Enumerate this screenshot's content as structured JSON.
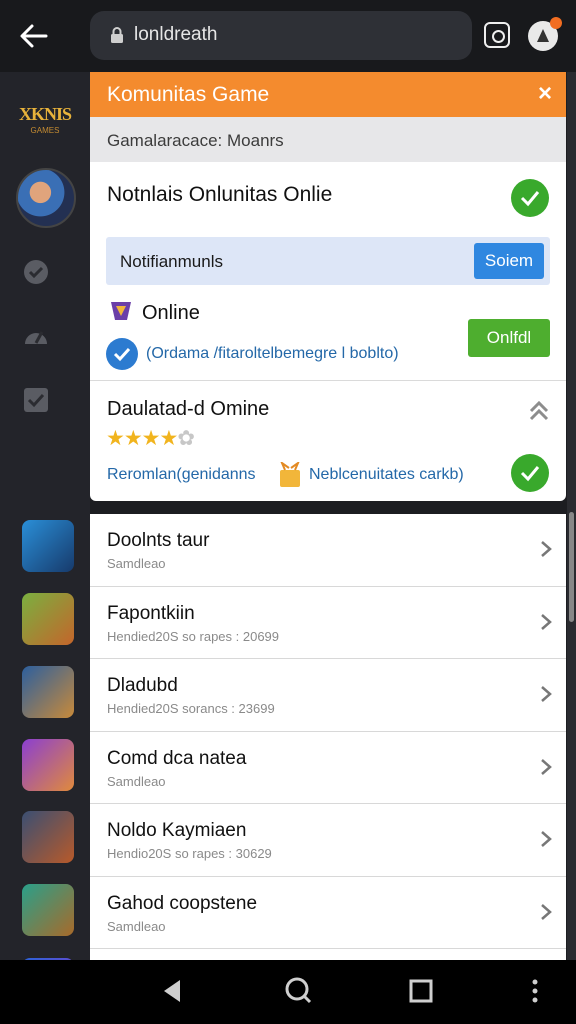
{
  "browser": {
    "url_text": "lonldreath",
    "back_icon": "back-arrow-icon",
    "lock_icon": "lock-icon",
    "camera_icon": "camera-icon"
  },
  "sidebar": {
    "logo_text": "XKNIS",
    "logo_sub": "GAMES"
  },
  "overlay": {
    "title": "Komunitas Game",
    "close_label": "×",
    "subheader": "Gamalaracace: Moanrs",
    "section1_title": "Notnlais Onlunitas Onlie",
    "notif_label": "Notifianmunls",
    "notif_button": "Soiem",
    "online_label": "Online",
    "online_button": "Onlfdl",
    "link_text": "(Ordama /fitaroltelbemegre l boblto)",
    "section2_title": "Daulatad-d Omine",
    "rating": 3.5,
    "footer_text_left": "Reromlan(genidanns",
    "footer_text_right": "Neblcenuitates carkb)",
    "colors": {
      "header": "#f48b2e",
      "button_blue": "#2f87e0",
      "button_green": "#4eae2f",
      "check_green": "#39a92c"
    }
  },
  "list": [
    {
      "name": "Doolnts taur",
      "meta": "Samdleao"
    },
    {
      "name": "Fapontkiin",
      "meta": "Hendied20S so rapes : 20699"
    },
    {
      "name": "Dladubd",
      "meta": "Hendied20S sorancs : 23699"
    },
    {
      "name": "Comd dca natea",
      "meta": "Samdleao"
    },
    {
      "name": "Noldo Kaymiaen",
      "meta": "Hendio20S so rapes : 30629"
    },
    {
      "name": "Gahod coopstene",
      "meta": "Samdleao"
    }
  ]
}
